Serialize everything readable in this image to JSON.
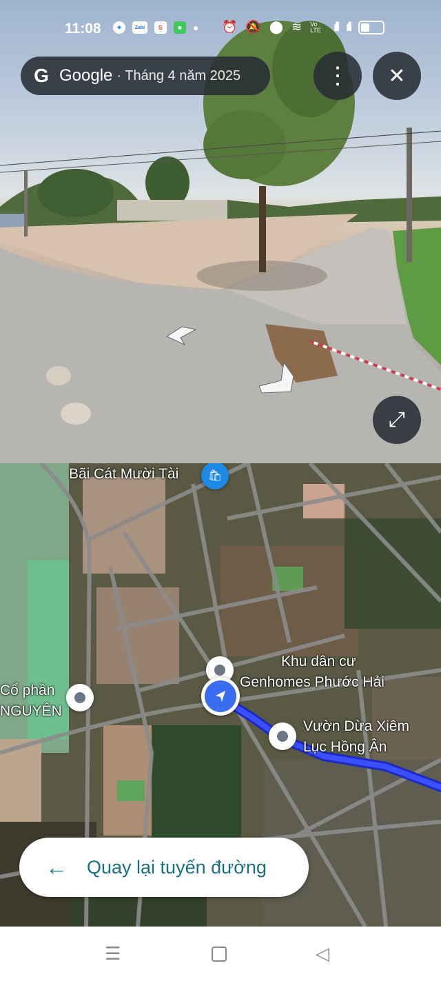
{
  "status_bar": {
    "time": "11:08",
    "notification_icons": [
      "messenger-icon",
      "zalo-icon",
      "shopee-icon",
      "chat-icon"
    ],
    "zalo_text": "Zalo",
    "shopee_text": "S",
    "vo_lte_text": "Vo LTE"
  },
  "streetview": {
    "provider": "Google",
    "date": "· Tháng 4 năm 2025",
    "more_icon": "more-vert-icon",
    "close_icon": "close-icon",
    "expand_icon": "expand-icon"
  },
  "map": {
    "labels": {
      "bai_cat": "Bãi Cát Mười Tài",
      "khu_dan_cu_1": "Khu dân cư",
      "khu_dan_cu_2": "Genhomes Phước Hải",
      "co_phan_1": "Cổ phần",
      "co_phan_2": "NGUYÊN",
      "vuon_dua_1": "Vườn Dừa Xiêm",
      "vuon_dua_2": "Lục Hồng Ân"
    },
    "route_color": "#2a3fe0",
    "back_button_label": "Quay lại tuyến đường"
  },
  "nav_bar": {
    "items": [
      "menu-icon",
      "home-icon",
      "back-icon"
    ]
  }
}
